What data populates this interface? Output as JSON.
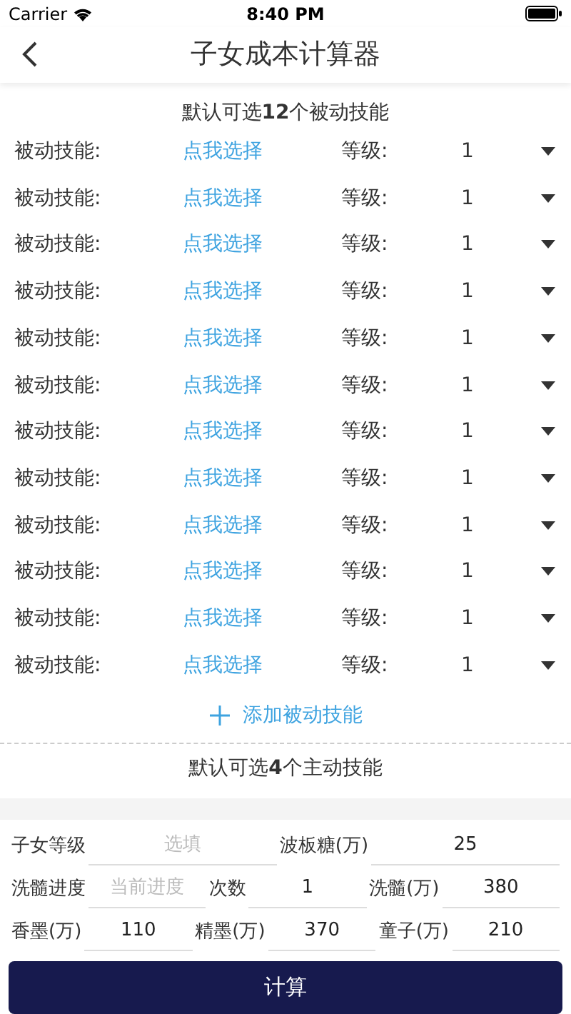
{
  "status_bar": {
    "carrier": "Carrier",
    "time": "8:40 PM"
  },
  "nav": {
    "title": "子女成本计算器"
  },
  "passive": {
    "heading": "默认可选**12**个被动技能",
    "rows": [
      {
        "label": "被动技能:",
        "picker": "点我选择",
        "level_label": "等级:",
        "level": "1"
      },
      {
        "label": "被动技能:",
        "picker": "点我选择",
        "level_label": "等级:",
        "level": "1"
      },
      {
        "label": "被动技能:",
        "picker": "点我选择",
        "level_label": "等级:",
        "level": "1"
      },
      {
        "label": "被动技能:",
        "picker": "点我选择",
        "level_label": "等级:",
        "level": "1"
      },
      {
        "label": "被动技能:",
        "picker": "点我选择",
        "level_label": "等级:",
        "level": "1"
      },
      {
        "label": "被动技能:",
        "picker": "点我选择",
        "level_label": "等级:",
        "level": "1"
      },
      {
        "label": "被动技能:",
        "picker": "点我选择",
        "level_label": "等级:",
        "level": "1"
      },
      {
        "label": "被动技能:",
        "picker": "点我选择",
        "level_label": "等级:",
        "level": "1"
      },
      {
        "label": "被动技能:",
        "picker": "点我选择",
        "level_label": "等级:",
        "level": "1"
      },
      {
        "label": "被动技能:",
        "picker": "点我选择",
        "level_label": "等级:",
        "level": "1"
      },
      {
        "label": "被动技能:",
        "picker": "点我选择",
        "level_label": "等级:",
        "level": "1"
      },
      {
        "label": "被动技能:",
        "picker": "点我选择",
        "level_label": "等级:",
        "level": "1"
      }
    ],
    "add_button": "添加被动技能"
  },
  "active": {
    "heading": "默认可选**4**个主动技能"
  },
  "form": [
    [
      {
        "label": "子女等级",
        "placeholder": "选填"
      },
      {
        "label": "波板糖(万)",
        "value": "25"
      }
    ],
    [
      {
        "label": "洗髓进度",
        "placeholder": "当前进度"
      },
      {
        "label": "次数",
        "value": "1"
      },
      {
        "label": "洗髓(万)",
        "value": "380"
      }
    ],
    [
      {
        "label": "香墨(万)",
        "value": "110"
      },
      {
        "label": "精墨(万)",
        "value": "370"
      },
      {
        "label": "童子(万)",
        "value": "210"
      }
    ]
  ],
  "calc_button": "计算"
}
